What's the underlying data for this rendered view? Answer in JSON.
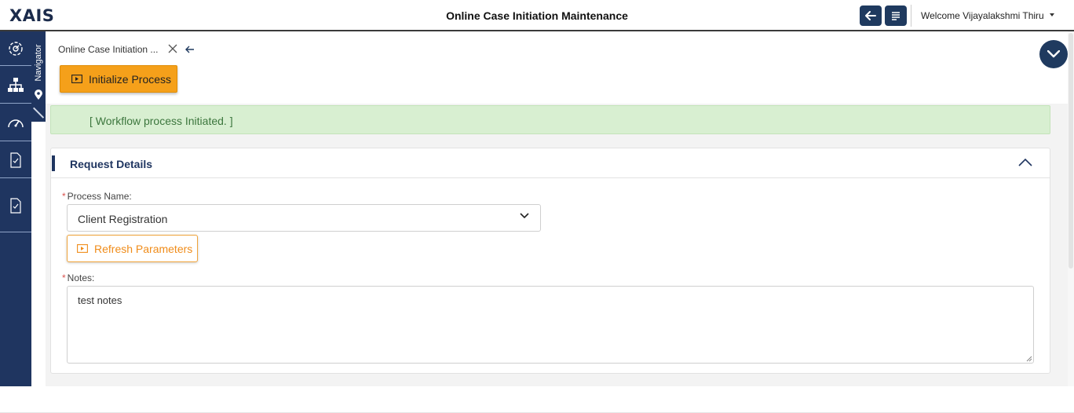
{
  "app": {
    "logo": "XAIS",
    "title": "Online Case Initiation Maintenance"
  },
  "header": {
    "welcome": "Welcome Vijayalakshmi Thiru"
  },
  "navigator": {
    "label": "Navigator"
  },
  "tab": {
    "label": "Online Case Initiation ..."
  },
  "toolbar": {
    "initialize_label": "Initialize Process"
  },
  "alert": {
    "message": "[ Workflow process Initiated. ]"
  },
  "panel": {
    "title": "Request Details",
    "process_name": {
      "label": "Process Name:",
      "value": "Client Registration"
    },
    "refresh_label": "Refresh Parameters",
    "notes": {
      "label": "Notes:",
      "value": "test notes"
    }
  },
  "colors": {
    "navy": "#1f3560",
    "orange": "#f5a01a",
    "success_bg": "#d8efd1",
    "success_text": "#3c763d"
  }
}
